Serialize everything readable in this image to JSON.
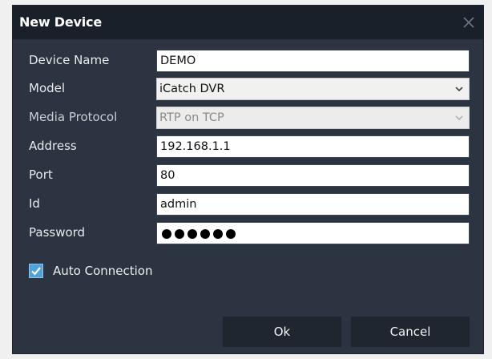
{
  "dialog": {
    "title": "New Device"
  },
  "form": {
    "device_name": {
      "label": "Device Name",
      "value": "DEMO"
    },
    "model": {
      "label": "Model",
      "value": "iCatch DVR"
    },
    "media_protocol": {
      "label": "Media Protocol",
      "value": "RTP on TCP",
      "disabled": true
    },
    "address": {
      "label": "Address",
      "value": "192.168.1.1"
    },
    "port": {
      "label": "Port",
      "value": "80"
    },
    "id": {
      "label": "Id",
      "value": "admin"
    },
    "password": {
      "label": "Password",
      "masked_length": 6
    }
  },
  "auto_connection": {
    "label": "Auto Connection",
    "checked": true
  },
  "buttons": {
    "ok": "Ok",
    "cancel": "Cancel"
  },
  "icons": {
    "close": "close-icon",
    "dropdown": "chevron-down-icon",
    "check": "checkmark-icon"
  },
  "colors": {
    "dialog_background": "#2b3440",
    "titlebar": "#1a2029",
    "checkbox_accent": "#4fa3d9",
    "button_background": "#1f262f"
  }
}
